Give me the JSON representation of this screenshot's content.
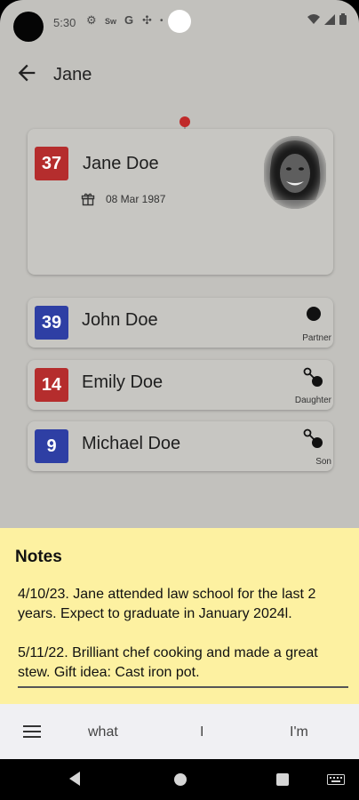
{
  "status_bar": {
    "time": "5:30",
    "icons": [
      "settings-icon",
      "swiftkey-icon",
      "google-icon",
      "pinwheel-icon",
      "dot-icon"
    ],
    "right_icons": [
      "wifi-icon",
      "signal-icon",
      "battery-icon"
    ]
  },
  "app_bar": {
    "title": "Jane"
  },
  "main_contact": {
    "age": "37",
    "name": "Jane Doe",
    "birthday": "08 Mar 1987",
    "badge_color": "#b52d2d"
  },
  "relations": [
    {
      "age": "39",
      "name": "John Doe",
      "label": "Partner",
      "icon": "partner-icon",
      "badge_color": "#2e3fa4"
    },
    {
      "age": "14",
      "name": "Emily Doe",
      "label": "Daughter",
      "icon": "child-icon",
      "badge_color": "#b52d2d"
    },
    {
      "age": "9",
      "name": "Michael Doe",
      "label": "Son",
      "icon": "child-icon",
      "badge_color": "#2e3fa4"
    }
  ],
  "notes": {
    "title": "Notes",
    "text": "4/10/23. Jane attended law school for the last 2 years. Expect to graduate in January 2024l.\n\n5/11/22. Brilliant chef cooking and made a great stew. Gift idea: Cast iron pot."
  },
  "keyboard": {
    "suggestions": [
      "what",
      "I",
      "I'm"
    ]
  },
  "colors": {
    "notes_background": "#fdf1a1",
    "accent_red": "#b52d2d",
    "accent_blue": "#2e3fa4"
  }
}
